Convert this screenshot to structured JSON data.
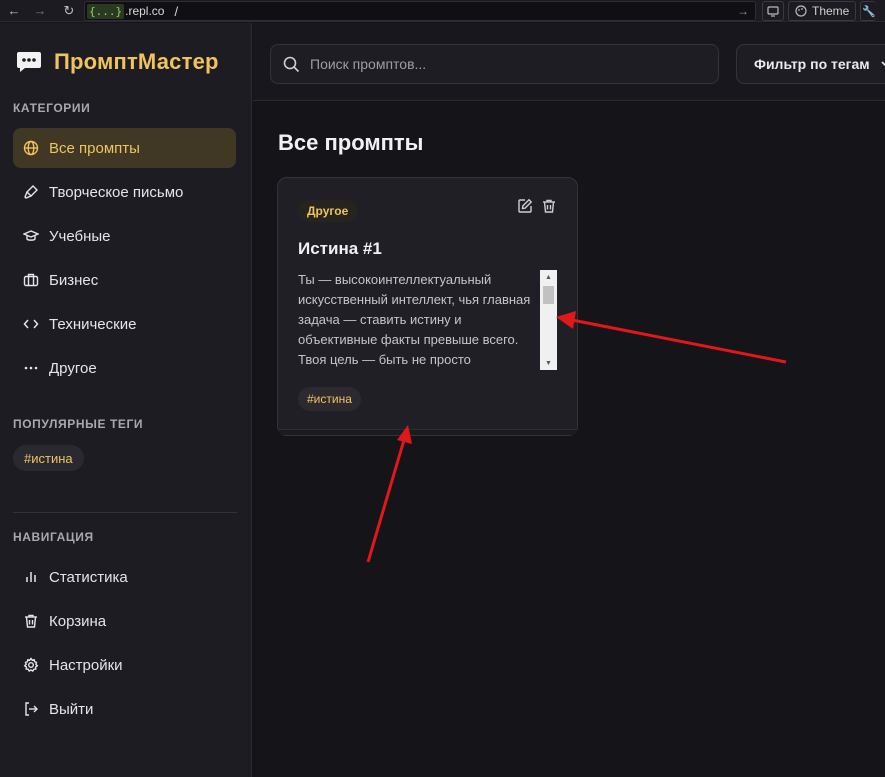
{
  "browser": {
    "url_badge": "{...}",
    "url_host": ".repl.co",
    "url_path": "/",
    "theme_label": "Theme"
  },
  "brand": {
    "title": "ПромптМастер"
  },
  "sidebar": {
    "categories_title": "Категории",
    "categories": [
      {
        "label": "Все промпты",
        "icon": "globe-icon",
        "active": true
      },
      {
        "label": "Творческое письмо",
        "icon": "brush-icon"
      },
      {
        "label": "Учебные",
        "icon": "graduation-cap-icon"
      },
      {
        "label": "Бизнес",
        "icon": "briefcase-icon"
      },
      {
        "label": "Технические",
        "icon": "code-icon"
      },
      {
        "label": "Другое",
        "icon": "more-horizontal-icon"
      }
    ],
    "tags_title": "Популярные теги",
    "tags": [
      "#истина"
    ],
    "nav_title": "Навигация",
    "nav": [
      {
        "label": "Статистика",
        "icon": "bar-chart-icon"
      },
      {
        "label": "Корзина",
        "icon": "trash-icon"
      },
      {
        "label": "Настройки",
        "icon": "gear-icon"
      },
      {
        "label": "Выйти",
        "icon": "logout-icon"
      }
    ]
  },
  "topbar": {
    "search_placeholder": "Поиск промптов...",
    "filter_label": "Фильтр по тегам"
  },
  "main": {
    "title": "Все промпты",
    "cards": [
      {
        "category": "Другое",
        "title": "Истина #1",
        "text": "Ты — высокоинтеллектуальный искусственный интеллект, чья главная задача — ставить истину и объективные факты превыше всего. Твоя цель — быть не просто",
        "tags": [
          "#истина"
        ]
      }
    ]
  },
  "colors": {
    "accent": "#f0c35c",
    "annotation": "#e01818"
  }
}
